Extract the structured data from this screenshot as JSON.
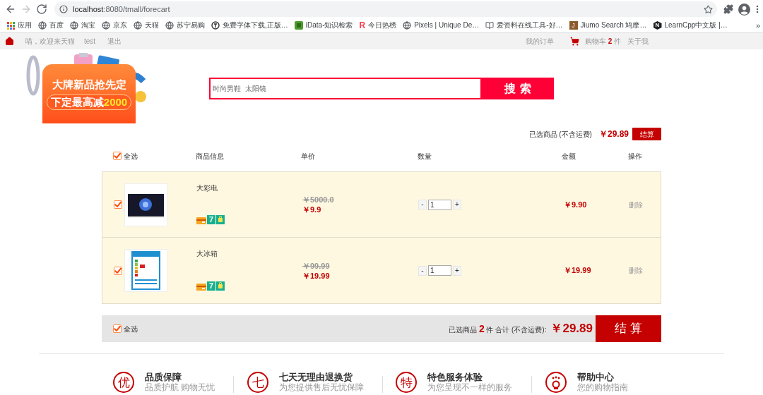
{
  "browser": {
    "nav": [
      {
        "kind": "back",
        "disabled": false
      },
      {
        "kind": "forward",
        "disabled": true
      },
      {
        "kind": "reload",
        "disabled": false
      }
    ],
    "url_host": "localhost",
    "url_path": ":8080/tmall/forecart"
  },
  "bookmarks": {
    "items": [
      {
        "kind": "apps",
        "label": "应用"
      },
      {
        "kind": "globe",
        "label": "百度"
      },
      {
        "kind": "globe",
        "label": "淘宝"
      },
      {
        "kind": "globe",
        "label": "京东"
      },
      {
        "kind": "globe",
        "label": "天猫"
      },
      {
        "kind": "globe",
        "label": "苏宁易购"
      },
      {
        "kind": "round",
        "label": "免费字体下载,正版…"
      },
      {
        "kind": "square",
        "label": "iData-知识检索"
      },
      {
        "kind": "letter",
        "icon_text": "R",
        "label": "今日热榜"
      },
      {
        "kind": "globe",
        "label": "Pixels | Unique De…"
      },
      {
        "kind": "book",
        "label": "爱资料在线工具-好…"
      },
      {
        "kind": "tile",
        "icon_text": "J",
        "label": "Jiumo Search 鸠摩…"
      },
      {
        "kind": "hexagon",
        "icon_text": "N",
        "label": "LearnCpp中文版 |…"
      }
    ],
    "more": "»"
  },
  "top_nav": {
    "greeting": "喵，欢迎来天猫",
    "user": "test",
    "logout": "退出",
    "orders": "我的订单",
    "cart_label": "购物车",
    "cart_count": "2",
    "cart_unit": "件",
    "about": "关于我"
  },
  "banner": {
    "headline": "大牌新品抢先定",
    "offer": "下定最高减",
    "offer_highlight": "2000"
  },
  "search": {
    "placeholder": "时尚男鞋  太阳镜",
    "button": "搜索"
  },
  "summary": {
    "label": "已选商品 (不含运费)",
    "total": "￥29.89",
    "button": "结算"
  },
  "table": {
    "select_all": {
      "label": "全选",
      "checked": true
    },
    "columns": [
      "商品信息",
      "单价",
      "数量",
      "金额",
      "操作"
    ]
  },
  "items": [
    {
      "selected": true,
      "photo": {
        "kind": "tv"
      },
      "name": "大彩电",
      "badges": [
        {
          "kind": "card"
        },
        {
          "kind": "days",
          "label": "7"
        },
        {
          "kind": "bag"
        }
      ],
      "old_price": "￥5000.0",
      "price": "￥9.9",
      "decrease": "-",
      "quantity": "1",
      "increase": "+",
      "amount": "￥9.90",
      "action": "删除"
    },
    {
      "selected": true,
      "photo": {
        "kind": "energy_label"
      },
      "name": "大冰箱",
      "badges": [
        {
          "kind": "card"
        },
        {
          "kind": "days",
          "label": "7"
        },
        {
          "kind": "bag"
        }
      ],
      "old_price": "￥99.99",
      "price": "￥19.99",
      "decrease": "-",
      "quantity": "1",
      "increase": "+",
      "amount": "￥19.99",
      "action": "删除"
    }
  ],
  "footer_bar": {
    "select_all": {
      "label": "全选",
      "checked": true
    },
    "selected_prefix": "已选商品",
    "selected_count": "2",
    "selected_suffix": "件 合计 (不含运费):",
    "total": "￥29.89",
    "button": "结算"
  },
  "services": [
    {
      "kind": "char",
      "emblem": "优",
      "title": "品质保障",
      "subtitle": "品质护航 购物无忧"
    },
    {
      "kind": "char",
      "emblem": "七",
      "title": "七天无理由退换货",
      "subtitle": "为您提供售后无忧保障"
    },
    {
      "kind": "char",
      "emblem": "特",
      "title": "特色服务体验",
      "subtitle": "为您呈现不一样的服务"
    },
    {
      "kind": "help",
      "title": "帮助中心",
      "subtitle": "您的购物指南"
    }
  ]
}
